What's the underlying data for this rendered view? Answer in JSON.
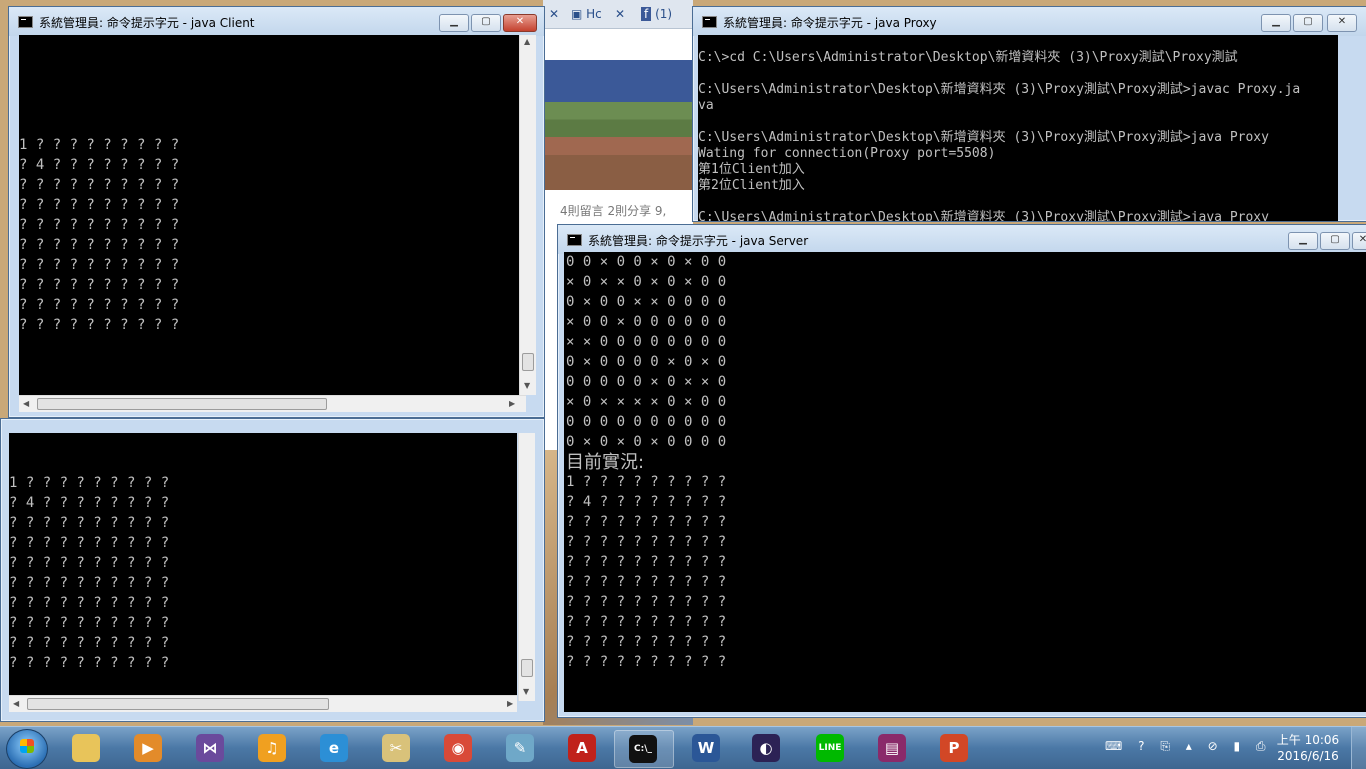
{
  "browser": {
    "tab1_label": "Hc",
    "tab2_label": "(1)",
    "stats_text": "4則留言   2則分享   9,"
  },
  "client_window": {
    "title": "系統管理員: 命令提示字元 - java  Client",
    "board_lines": [
      "1 ? ? ? ? ? ? ? ? ?",
      "? 4 ? ? ? ? ? ? ? ?",
      "? ? ? ? ? ? ? ? ? ?",
      "? ? ? ? ? ? ? ? ? ?",
      "? ? ? ? ? ? ? ? ? ?",
      "? ? ? ? ? ? ? ? ? ?",
      "? ? ? ? ? ? ? ? ? ?",
      "? ? ? ? ? ? ? ? ? ?",
      "? ? ? ? ? ? ? ? ? ?",
      "? ? ? ? ? ? ? ? ? ?"
    ]
  },
  "client2_window": {
    "board_lines": [
      "1 ? ? ? ? ? ? ? ? ?",
      "? 4 ? ? ? ? ? ? ? ?",
      "? ? ? ? ? ? ? ? ? ?",
      "? ? ? ? ? ? ? ? ? ?",
      "? ? ? ? ? ? ? ? ? ?",
      "? ? ? ? ? ? ? ? ? ?",
      "? ? ? ? ? ? ? ? ? ?",
      "? ? ? ? ? ? ? ? ? ?",
      "? ? ? ? ? ? ? ? ? ?",
      "? ? ? ? ? ? ? ? ? ?"
    ]
  },
  "proxy_window": {
    "title": "系統管理員: 命令提示字元 - java  Proxy",
    "lines": [
      "C:\\>cd C:\\Users\\Administrator\\Desktop\\新增資料夾 (3)\\Proxy測試\\Proxy測試",
      "",
      "C:\\Users\\Administrator\\Desktop\\新增資料夾 (3)\\Proxy測試\\Proxy測試>javac Proxy.ja",
      "va",
      "",
      "C:\\Users\\Administrator\\Desktop\\新增資料夾 (3)\\Proxy測試\\Proxy測試>java Proxy",
      "Wating for connection(Proxy port=5508)",
      "第1位Client加入",
      "第2位Client加入",
      "",
      "C:\\Users\\Administrator\\Desktop\\新增資料夾 (3)\\Proxy測試\\Proxy測試>java Proxy"
    ]
  },
  "server_window": {
    "title": "系統管理員: 命令提示字元 - java  Server",
    "mine_lines": [
      "0 0 × 0 0 × 0 × 0 0",
      "× 0 × × 0 × 0 × 0 0",
      "0 × 0 0 × × 0 0 0 0",
      "× 0 0 × 0 0 0 0 0 0",
      "× × 0 0 0 0 0 0 0 0",
      "0 × 0 0 0 0 × 0 × 0",
      "0 0 0 0 0 × 0 × × 0",
      "× 0 × × × × 0 × 0 0",
      "0 0 0 0 0 0 0 0 0 0",
      "0 × 0 × 0 × 0 0 0 0"
    ],
    "status_label": "目前實況:",
    "board_lines": [
      "1 ? ? ? ? ? ? ? ? ?",
      "? 4 ? ? ? ? ? ? ? ?",
      "? ? ? ? ? ? ? ? ? ?",
      "? ? ? ? ? ? ? ? ? ?",
      "? ? ? ? ? ? ? ? ? ?",
      "? ? ? ? ? ? ? ? ? ?",
      "? ? ? ? ? ? ? ? ? ?",
      "? ? ? ? ? ? ? ? ? ?",
      "? ? ? ? ? ? ? ? ? ?",
      "? ? ? ? ? ? ? ? ? ?"
    ]
  },
  "taskbar": {
    "apps": [
      {
        "name": "file-explorer-icon",
        "glyph": "",
        "color": "#e8c45a"
      },
      {
        "name": "media-player-icon",
        "glyph": "▶",
        "color": "#e38b2a"
      },
      {
        "name": "visual-studio-icon",
        "glyph": "⋈",
        "color": "#6a4a9c"
      },
      {
        "name": "headset-icon",
        "glyph": "♫",
        "color": "#f0a020"
      },
      {
        "name": "internet-explorer-icon",
        "glyph": "e",
        "color": "#2c8fd6"
      },
      {
        "name": "snipping-tool-icon",
        "glyph": "✂",
        "color": "#d9c27a"
      },
      {
        "name": "chrome-icon",
        "glyph": "◉",
        "color": "#d94a38"
      },
      {
        "name": "notepad-icon",
        "glyph": "✎",
        "color": "#6fa8c8"
      },
      {
        "name": "acrobat-icon",
        "glyph": "A",
        "color": "#c0221b"
      },
      {
        "name": "command-prompt-icon",
        "glyph": "C:\\_",
        "color": "#111111"
      },
      {
        "name": "word-icon",
        "glyph": "W",
        "color": "#2b5797"
      },
      {
        "name": "eclipse-icon",
        "glyph": "◐",
        "color": "#2c2255"
      },
      {
        "name": "line-icon",
        "glyph": "LINE",
        "color": "#00b900"
      },
      {
        "name": "winrar-icon",
        "glyph": "▤",
        "color": "#8a2a6a"
      },
      {
        "name": "powerpoint-icon",
        "glyph": "P",
        "color": "#d24726"
      }
    ],
    "tray_icons": "⌨ ? ⎘ ▴ ⊘ ▮ ⎙",
    "time": "上午 10:06",
    "date": "2016/6/16"
  }
}
